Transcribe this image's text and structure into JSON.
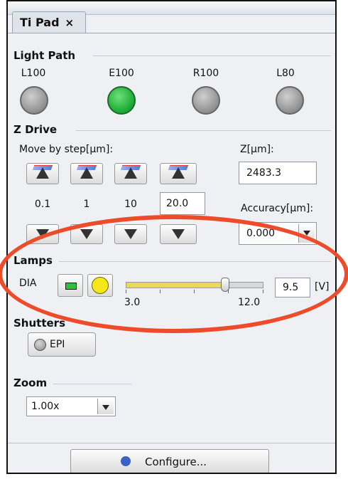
{
  "tab": {
    "title": "Ti Pad",
    "close": "×"
  },
  "light_path": {
    "group": "Light Path",
    "items": [
      {
        "label": "L100",
        "active": false
      },
      {
        "label": "E100",
        "active": true
      },
      {
        "label": "R100",
        "active": false
      },
      {
        "label": "L80",
        "active": false
      }
    ]
  },
  "z_drive": {
    "group": "Z Drive",
    "move_label": "Move by step[µm]:",
    "steps": [
      "0.1",
      "1",
      "10"
    ],
    "custom_step": "20.0",
    "z_label": "Z[µm]:",
    "z_value": "2483.3",
    "accuracy_label": "Accuracy[µm]:",
    "accuracy_value": "0.000"
  },
  "lamps": {
    "group": "Lamps",
    "dia_label": "DIA",
    "slider_min": "3.0",
    "slider_max": "12.0",
    "value": "9.5",
    "unit": "[V]",
    "level": 9.5,
    "min": 3.0,
    "max": 12.0
  },
  "shutters": {
    "group": "Shutters",
    "epi_label": "EPI"
  },
  "zoom": {
    "group": "Zoom",
    "value": "1.00x"
  },
  "configure_label": "Configure...",
  "colors": {
    "highlight_oval": "#ee4b2b",
    "lamp_on": "#18a832",
    "slider_fill": "#e8d95a"
  }
}
